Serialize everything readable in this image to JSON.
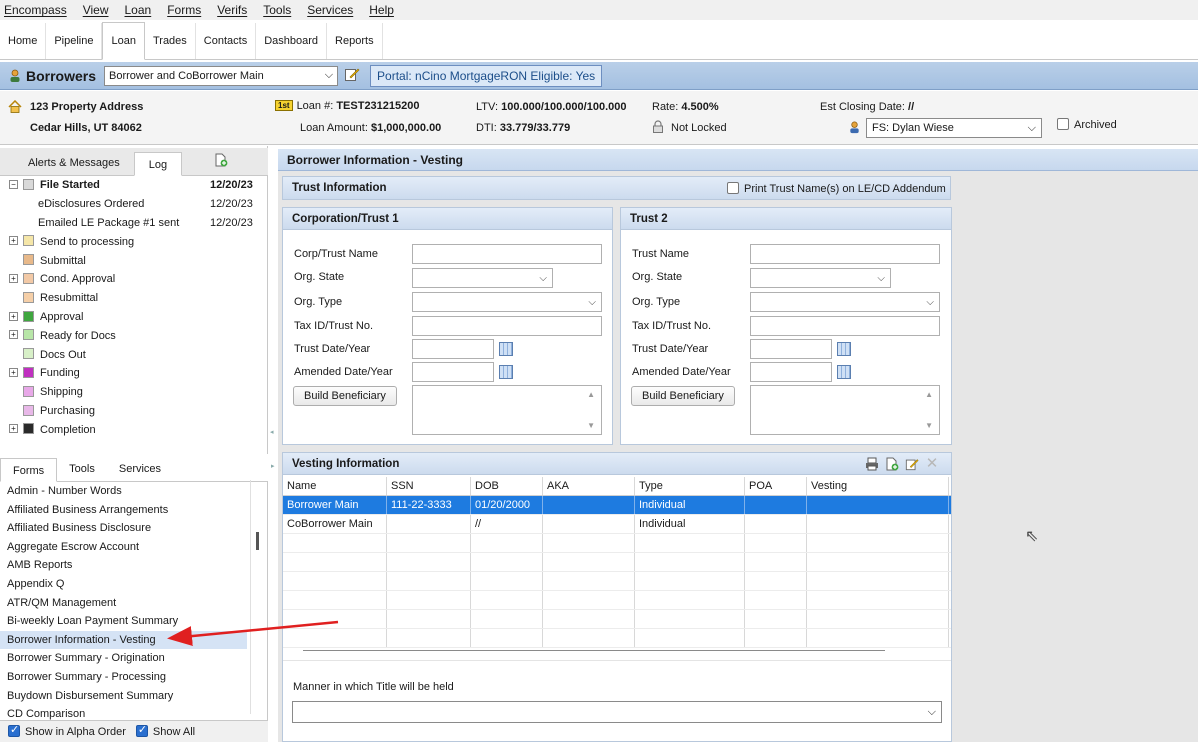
{
  "menu": [
    "Encompass",
    "View",
    "Loan",
    "Forms",
    "Verifs",
    "Tools",
    "Services",
    "Help"
  ],
  "tabs": [
    "Home",
    "Pipeline",
    "Loan",
    "Trades",
    "Contacts",
    "Dashboard",
    "Reports"
  ],
  "borrowers": {
    "title": "Borrowers",
    "selected_pair": "Borrower and CoBorrower Main",
    "portal_badge": "Portal: nCino MortgageRON Eligible: Yes"
  },
  "loan_header": {
    "address_line1": "123 Property Address",
    "address_line2": "Cedar Hills, UT 84062",
    "lien_badge": "1st",
    "loan_number_label": "Loan #:",
    "loan_number": "TEST231215200",
    "loan_amount_label": "Loan Amount:",
    "loan_amount": "$1,000,000.00",
    "ltv_label": "LTV:",
    "ltv": "100.000/100.000/100.000",
    "dti_label": "DTI:",
    "dti": "33.779/33.779",
    "rate_label": "Rate:",
    "rate": "4.500%",
    "lock_status": "Not Locked",
    "est_closing_label": "Est Closing Date:",
    "est_closing": "//",
    "assigned_user": "FS: Dylan Wiese",
    "archived_label": "Archived"
  },
  "left_tabs_top": [
    "Alerts & Messages",
    "Log"
  ],
  "log": [
    {
      "label": "File Started",
      "date": "12/20/23",
      "bold": true,
      "expander": "−",
      "color": "#d9d9d9"
    },
    {
      "label": "eDisclosures Ordered",
      "date": "12/20/23",
      "bold": false,
      "expander": "",
      "color": ""
    },
    {
      "label": "Emailed LE Package #1 sent",
      "date": "12/20/23",
      "bold": false,
      "expander": "",
      "color": ""
    },
    {
      "label": "Send to processing",
      "date": "",
      "bold": false,
      "expander": "+",
      "color": "#f5e6a8"
    },
    {
      "label": "Submittal",
      "date": "",
      "bold": false,
      "expander": "",
      "color": "#e8b98a"
    },
    {
      "label": "Cond. Approval",
      "date": "",
      "bold": false,
      "expander": "+",
      "color": "#f2c9a6"
    },
    {
      "label": "Resubmittal",
      "date": "",
      "bold": false,
      "expander": "",
      "color": "#f5cfa8"
    },
    {
      "label": "Approval",
      "date": "",
      "bold": false,
      "expander": "+",
      "color": "#3fa63f"
    },
    {
      "label": "Ready for Docs",
      "date": "",
      "bold": false,
      "expander": "+",
      "color": "#b8e6a8"
    },
    {
      "label": "Docs Out",
      "date": "",
      "bold": false,
      "expander": "",
      "color": "#d8f0c8"
    },
    {
      "label": "Funding",
      "date": "",
      "bold": false,
      "expander": "+",
      "color": "#c02fc0"
    },
    {
      "label": "Shipping",
      "date": "",
      "bold": false,
      "expander": "",
      "color": "#e8a8e8"
    },
    {
      "label": "Purchasing",
      "date": "",
      "bold": false,
      "expander": "",
      "color": "#e8b8e8"
    },
    {
      "label": "Completion",
      "date": "",
      "bold": false,
      "expander": "+",
      "color": "#2a2a2a"
    }
  ],
  "left_tabs_bottom": [
    "Forms",
    "Tools",
    "Services"
  ],
  "forms": [
    "Admin - Number Words",
    "Affiliated Business Arrangements",
    "Affiliated Business Disclosure",
    "Aggregate Escrow Account",
    "AMB Reports",
    "Appendix Q",
    "ATR/QM Management",
    "Bi-weekly Loan Payment Summary",
    "Borrower Information - Vesting",
    "Borrower Summary - Origination",
    "Borrower Summary - Processing",
    "Buydown Disbursement Summary",
    "CD Comparison"
  ],
  "selected_form_index": 8,
  "left_bottom": {
    "alpha_label": "Show in Alpha Order",
    "showall_label": "Show All"
  },
  "main_title": "Borrower Information - Vesting",
  "trust_info": {
    "title": "Trust Information",
    "print_label": "Print Trust Name(s) on LE/CD Addendum"
  },
  "corp_trust": {
    "title": "Corporation/Trust 1",
    "name_label": "Corp/Trust Name",
    "state_label": "Org. State",
    "type_label": "Org. Type",
    "taxid_label": "Tax ID/Trust No.",
    "date_label": "Trust Date/Year",
    "amended_label": "Amended Date/Year",
    "button": "Build Beneficiary"
  },
  "trust2": {
    "title": "Trust 2",
    "name_label": "Trust Name",
    "state_label": "Org. State",
    "type_label": "Org. Type",
    "taxid_label": "Tax ID/Trust No.",
    "date_label": "Trust Date/Year",
    "amended_label": "Amended Date/Year",
    "button": "Build Beneficiary"
  },
  "vesting": {
    "title": "Vesting Information",
    "columns": [
      "Name",
      "SSN",
      "DOB",
      "AKA",
      "Type",
      "POA",
      "Vesting"
    ],
    "rows": [
      [
        "Borrower Main",
        "111-22-3333",
        "01/20/2000",
        "",
        "Individual",
        "",
        ""
      ],
      [
        "CoBorrower Main",
        "",
        "//",
        "",
        "Individual",
        "",
        ""
      ]
    ]
  },
  "manner": {
    "label": "Manner in which Title will be held",
    "value": ""
  },
  "colors": {
    "accent": "#1e7be0",
    "header_blue": "#a4c0e1",
    "annotation_arrow": "#e02020"
  }
}
